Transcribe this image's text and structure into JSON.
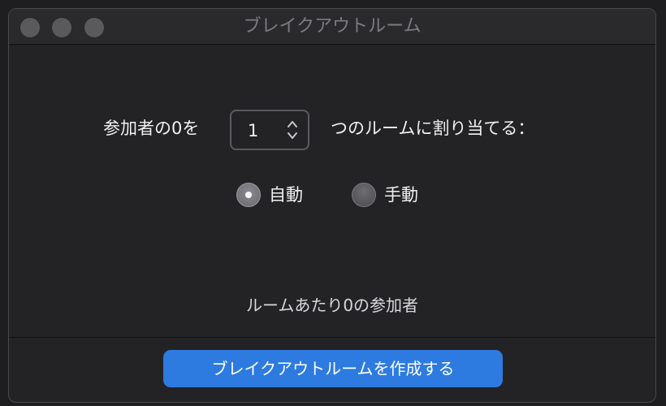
{
  "window": {
    "title": "ブレイクアウトルーム"
  },
  "assign": {
    "prefix_label": "参加者の0を",
    "room_count": "1",
    "suffix_label": "つのルームに割り当てる："
  },
  "mode": {
    "options": [
      {
        "label": "自動",
        "selected": true
      },
      {
        "label": "手動",
        "selected": false
      }
    ]
  },
  "summary": {
    "per_room_text": "ルームあたり0の参加者"
  },
  "footer": {
    "create_button_label": "ブレイクアウトルームを作成する"
  },
  "colors": {
    "accent": "#2d7be0",
    "window_bg": "#232326"
  }
}
